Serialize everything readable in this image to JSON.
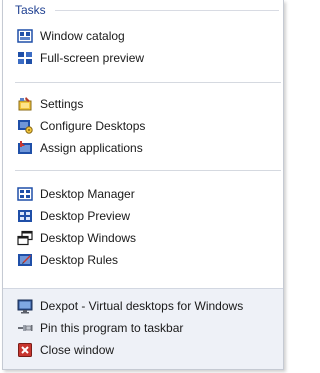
{
  "header": {
    "title": "Tasks"
  },
  "tasks_group_1": [
    {
      "label": "Window catalog",
      "icon": "window-catalog-icon"
    },
    {
      "label": "Full-screen preview",
      "icon": "fullscreen-preview-icon"
    }
  ],
  "tasks_group_2": [
    {
      "label": "Settings",
      "icon": "settings-icon"
    },
    {
      "label": "Configure Desktops",
      "icon": "configure-desktops-icon"
    },
    {
      "label": "Assign applications",
      "icon": "assign-applications-icon"
    }
  ],
  "tasks_group_3": [
    {
      "label": "Desktop Manager",
      "icon": "desktop-manager-icon"
    },
    {
      "label": "Desktop Preview",
      "icon": "desktop-preview-icon"
    },
    {
      "label": "Desktop Windows",
      "icon": "desktop-windows-icon"
    },
    {
      "label": "Desktop Rules",
      "icon": "desktop-rules-icon"
    }
  ],
  "footer": {
    "app_label": "Dexpot - Virtual desktops for Windows",
    "pin_label": "Pin this program to taskbar",
    "close_label": "Close window"
  },
  "colors": {
    "header_text": "#1e3f91",
    "icon_blue": "#1f4fa8",
    "close_red": "#c8362f"
  }
}
